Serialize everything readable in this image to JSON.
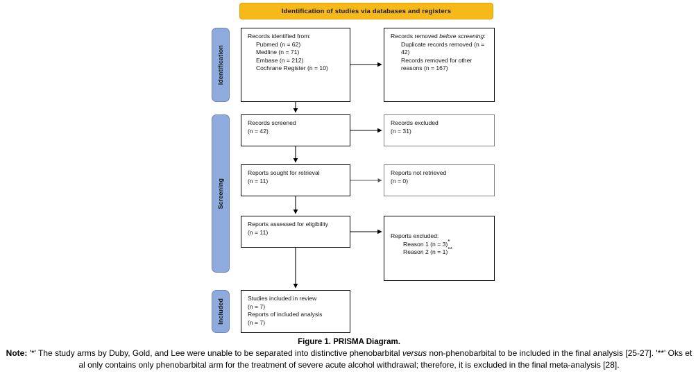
{
  "banner": {
    "label": "Identification  of  studies  via databases and registers",
    "color": "#F7B91A"
  },
  "rails": [
    {
      "name": "identification",
      "label": "Identification",
      "color": "#8FAADC"
    },
    {
      "name": "screening",
      "label": "Screening",
      "color": "#8FAADC"
    },
    {
      "name": "included",
      "label": "Included",
      "color": "#8FAADC"
    }
  ],
  "boxes": {
    "identified": {
      "title": "Records identified from:",
      "lines": [
        "Pubmed (n = 62)",
        "Medline (n = 71)",
        "Embase (n = 212)",
        "Cochrane Register (n = 10)"
      ],
      "text": "Records identified from:\n     Pubmed (n = 62)\n     Medline (n = 71)\n     Embase (n = 212)\n     Cochrane Register (n = 10)"
    },
    "removed": {
      "title": "Records removed before screening:",
      "lines": [
        "Duplicate records removed (n = 42)",
        "Records removed for other reasons (n = 167)"
      ]
    },
    "screened": {
      "text": "Records screened\n(n = 42)"
    },
    "excluded": {
      "text": "Records excluded\n(n = 31)"
    },
    "sought": {
      "text": "Reports sought for retrieval\n(n = 11)"
    },
    "not_retrieved": {
      "text": "Reports not retrieved\n(n = 0)"
    },
    "assessed": {
      "text": "Reports assessed for eligibility\n(n = 11)"
    },
    "reports_excluded": {
      "title": "Reports excluded:",
      "reason1": "Reason 1 (n = 3)",
      "reason1_mark": "*",
      "reason2": "Reason 2 (n = 1)",
      "reason2_mark": "**"
    },
    "included": {
      "text": "Studies included in review\n(n = 7)\nReports of included analysis\n(n = 7)"
    }
  },
  "caption": {
    "figure_title": "Figure 1. PRISMA Diagram.",
    "note_label": "Note:",
    "note_mark1": "'*'",
    "note_part1": " The study arms by Duby, Gold, and Lee were unable to be separated into distinctive phenobarbital ",
    "note_italic1": "versus",
    "note_part2": " non-phenobarbital to be included in the final analysis [25-27]. ",
    "note_mark2": "'**'",
    "note_part3": " Oks et al only contains only phenobarbital arm for the treatment of severe acute alcohol withdrawal; therefore, it is excluded in the final meta-analysis [28]."
  }
}
